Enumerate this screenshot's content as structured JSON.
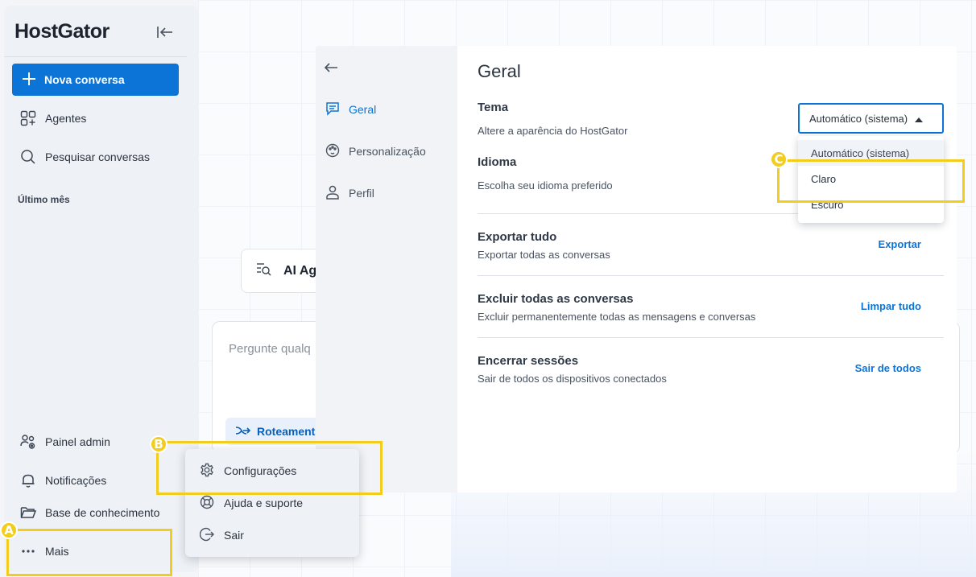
{
  "app": {
    "brand": "HostGator"
  },
  "sidebar": {
    "new_conversation": "Nova conversa",
    "items": [
      {
        "label": "Agentes",
        "icon": "agents-icon"
      },
      {
        "label": "Pesquisar conversas",
        "icon": "search-icon"
      }
    ],
    "section_label": "Último mês",
    "bottom_items": [
      {
        "label": "Painel admin",
        "icon": "admin-users-icon"
      },
      {
        "label": "Notificações",
        "icon": "bell-icon"
      },
      {
        "label": "Base de conhecimento",
        "icon": "folder-icon"
      },
      {
        "label": "Mais",
        "icon": "more-dots-icon"
      }
    ]
  },
  "main": {
    "agent_card_label": "AI Ag",
    "prompt_placeholder": "Pergunte qualq",
    "routing_chip": "Roteamento"
  },
  "settings": {
    "nav": [
      {
        "label": "Geral",
        "icon": "chat-icon",
        "active": true
      },
      {
        "label": "Personalização",
        "icon": "palette-icon",
        "active": false
      },
      {
        "label": "Perfil",
        "icon": "person-icon",
        "active": false
      }
    ],
    "title": "Geral",
    "theme": {
      "title": "Tema",
      "description": "Altere a aparência do HostGator",
      "selected": "Automático (sistema)",
      "options": [
        "Automático (sistema)",
        "Claro",
        "Escuro"
      ]
    },
    "language": {
      "title": "Idioma",
      "description": "Escolha seu idioma preferido"
    },
    "export": {
      "title": "Exportar tudo",
      "description": "Exportar todas as conversas",
      "action": "Exportar"
    },
    "delete": {
      "title": "Excluir todas as conversas",
      "description": "Excluir permanentemente todas as mensagens e conversas",
      "action": "Limpar tudo"
    },
    "sessions": {
      "title": "Encerrar sessões",
      "description": "Sair de todos os dispositivos conectados",
      "action": "Sair de todos"
    }
  },
  "popup_menu": {
    "items": [
      {
        "label": "Configurações",
        "icon": "gear-icon"
      },
      {
        "label": "Ajuda e suporte",
        "icon": "lifebuoy-icon"
      },
      {
        "label": "Sair",
        "icon": "logout-icon"
      }
    ]
  },
  "annotations": {
    "a": "A",
    "b": "B",
    "c": "C",
    "color": "#f2cd1d"
  },
  "colors": {
    "accent": "#0b74d6",
    "sidebar_bg": "#eef1f5"
  }
}
